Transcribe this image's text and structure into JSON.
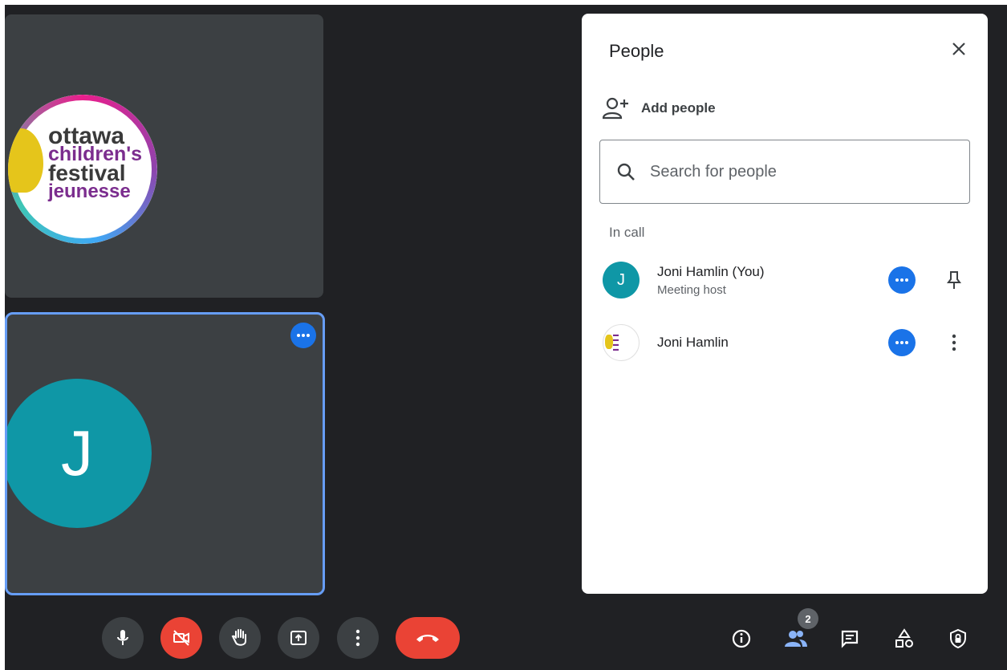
{
  "tiles": {
    "top": {
      "logo_lines": [
        "ottawa",
        "children's",
        "festival",
        "jeunesse"
      ]
    },
    "bottom": {
      "avatar_letter": "J"
    }
  },
  "panel": {
    "title": "People",
    "add_people_label": "Add people",
    "search_placeholder": "Search for people",
    "section_label": "In call",
    "people": [
      {
        "name": "Joni Hamlin (You)",
        "role": "Meeting host",
        "avatar_letter": "J"
      },
      {
        "name": "Joni Hamlin",
        "role": ""
      }
    ]
  },
  "controls": {
    "icons": [
      "mic-icon",
      "camera-off-icon",
      "raise-hand-icon",
      "present-icon",
      "more-options-icon",
      "end-call-icon"
    ]
  },
  "right_controls": {
    "people_count": "2",
    "icons": [
      "info-icon",
      "people-icon",
      "chat-icon",
      "activities-icon",
      "host-controls-icon"
    ]
  },
  "colors": {
    "background": "#202124",
    "tile": "#3c4043",
    "accent_blue": "#1a73e8",
    "danger_red": "#ea4335",
    "avatar_teal": "#0f97a6"
  }
}
